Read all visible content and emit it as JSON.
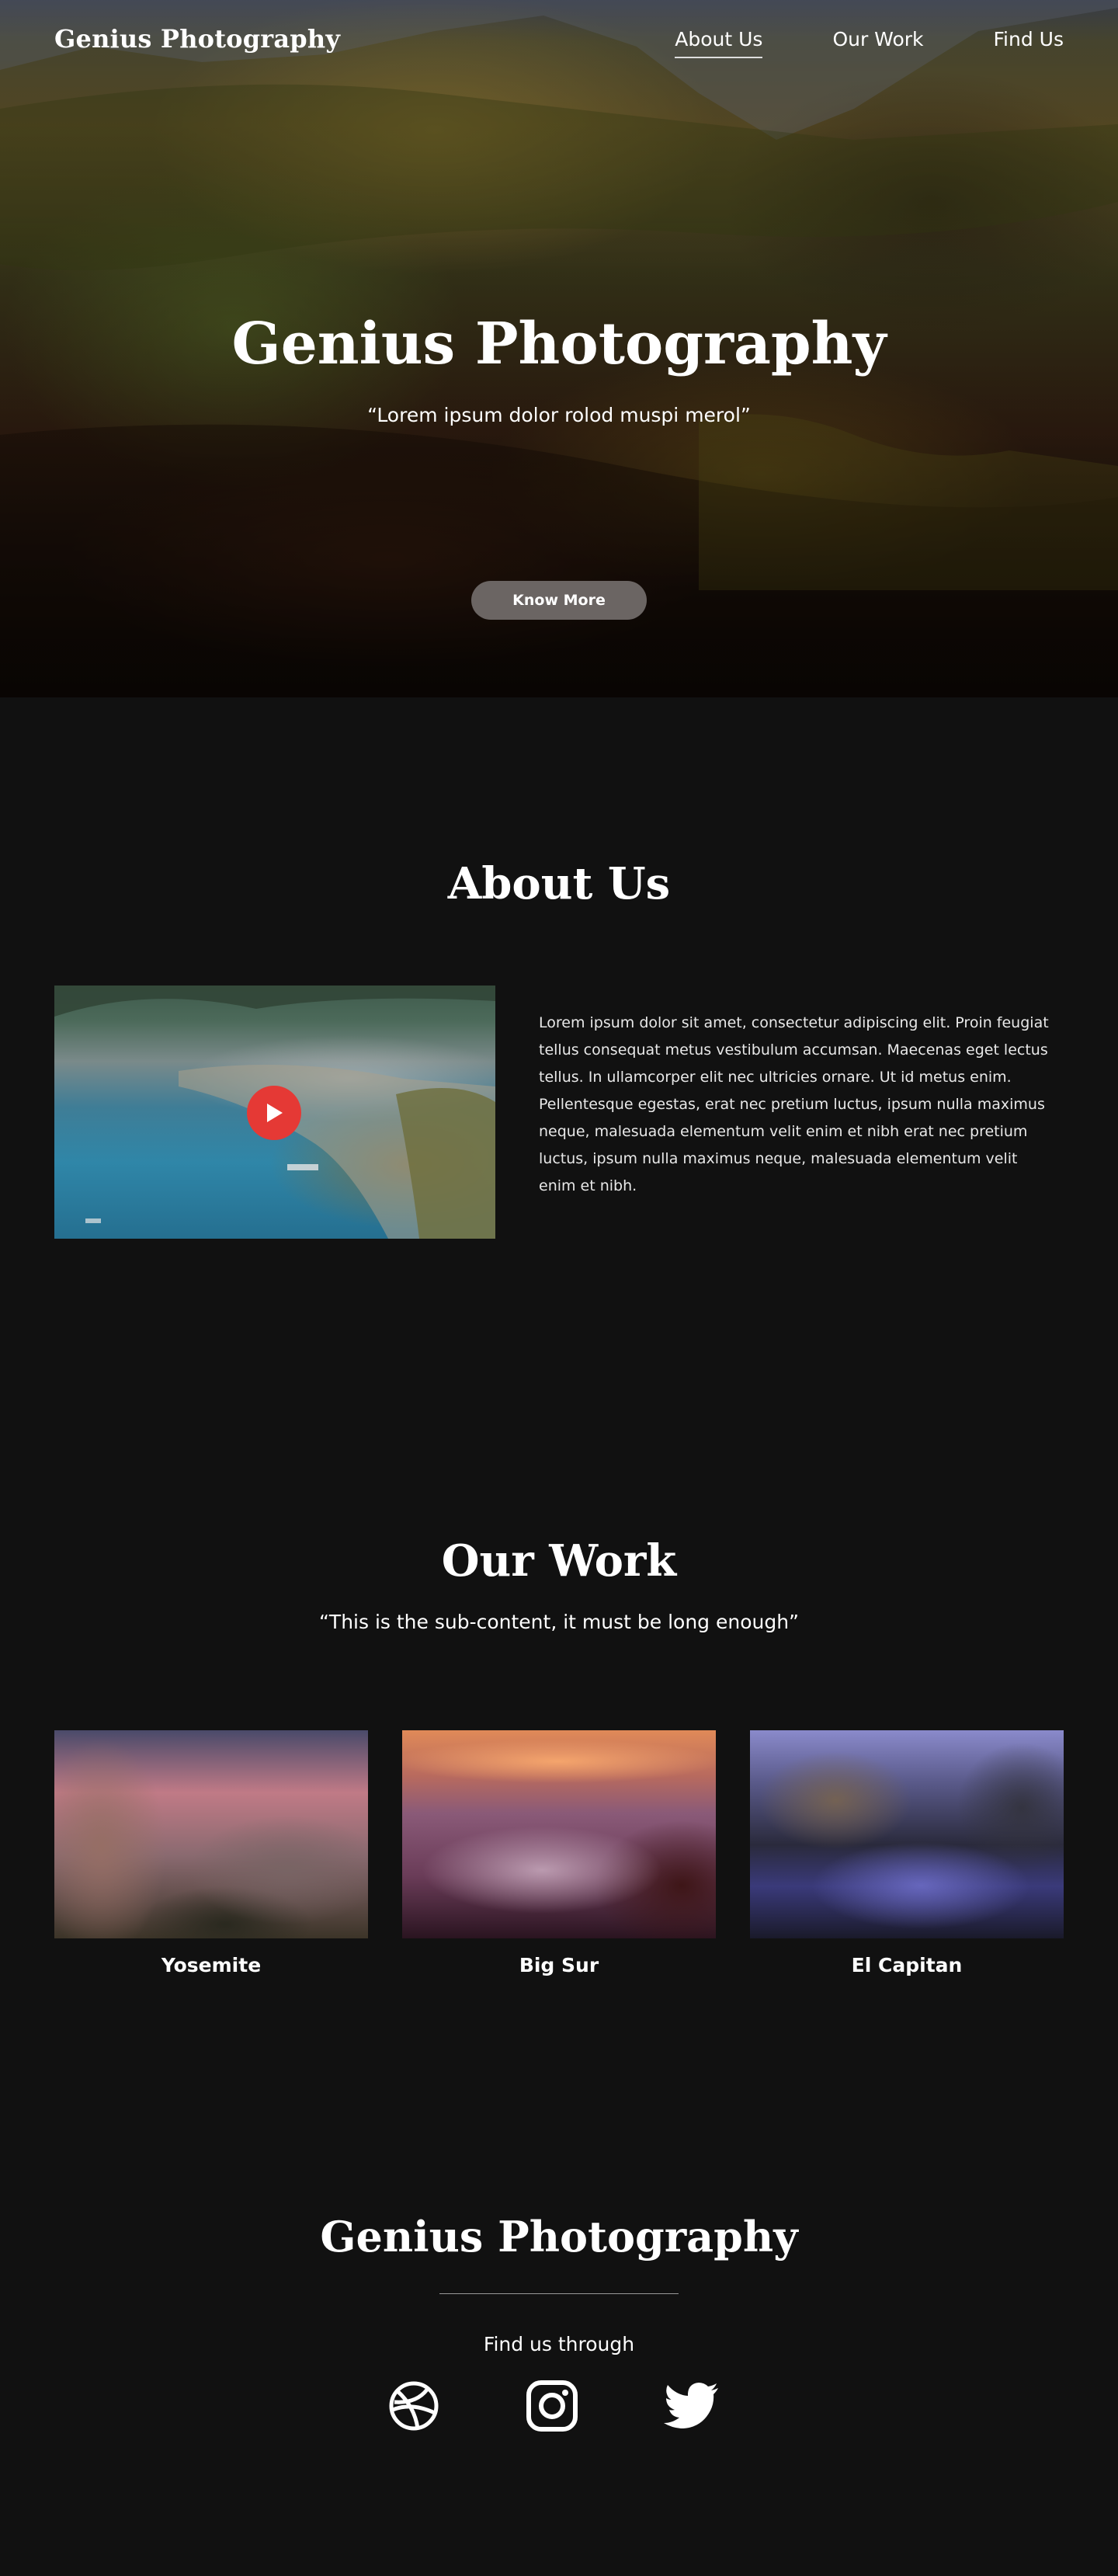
{
  "nav": {
    "brand": "Genius Photography",
    "links": [
      "About Us",
      "Our Work",
      "Find Us"
    ]
  },
  "hero": {
    "title": "Genius Photography",
    "quote": "“Lorem ipsum dolor rolod muspi merol”",
    "button_label": "Know More"
  },
  "about": {
    "title": "About Us",
    "paragraph": "Lorem ipsum dolor sit amet, consectetur adipiscing elit. Proin feugiat tellus consequat metus vestibulum accumsan. Maecenas eget lectus tellus. In ullamcorper elit nec ultricies ornare. Ut id metus enim. Pellentesque egestas, erat nec pretium luctus, ipsum nulla maximus neque, malesuada elementum velit enim et nibh erat nec pretium luctus, ipsum nulla maximus neque, malesuada elementum velit enim et nibh.",
    "play_icon": "play-icon"
  },
  "work": {
    "title": "Our Work",
    "subtitle": "“This is the sub-content, it must be long enough”",
    "items": [
      {
        "label": "Yosemite"
      },
      {
        "label": "Big Sur"
      },
      {
        "label": "El Capitan"
      }
    ]
  },
  "footer": {
    "brand": "Genius Photography",
    "find_text": "Find us through",
    "social_icons": [
      "dribbble-icon",
      "instagram-icon",
      "twitter-icon"
    ]
  },
  "colors": {
    "background": "#111111",
    "play_button": "#e53935",
    "hero_button": "#6b6563"
  }
}
